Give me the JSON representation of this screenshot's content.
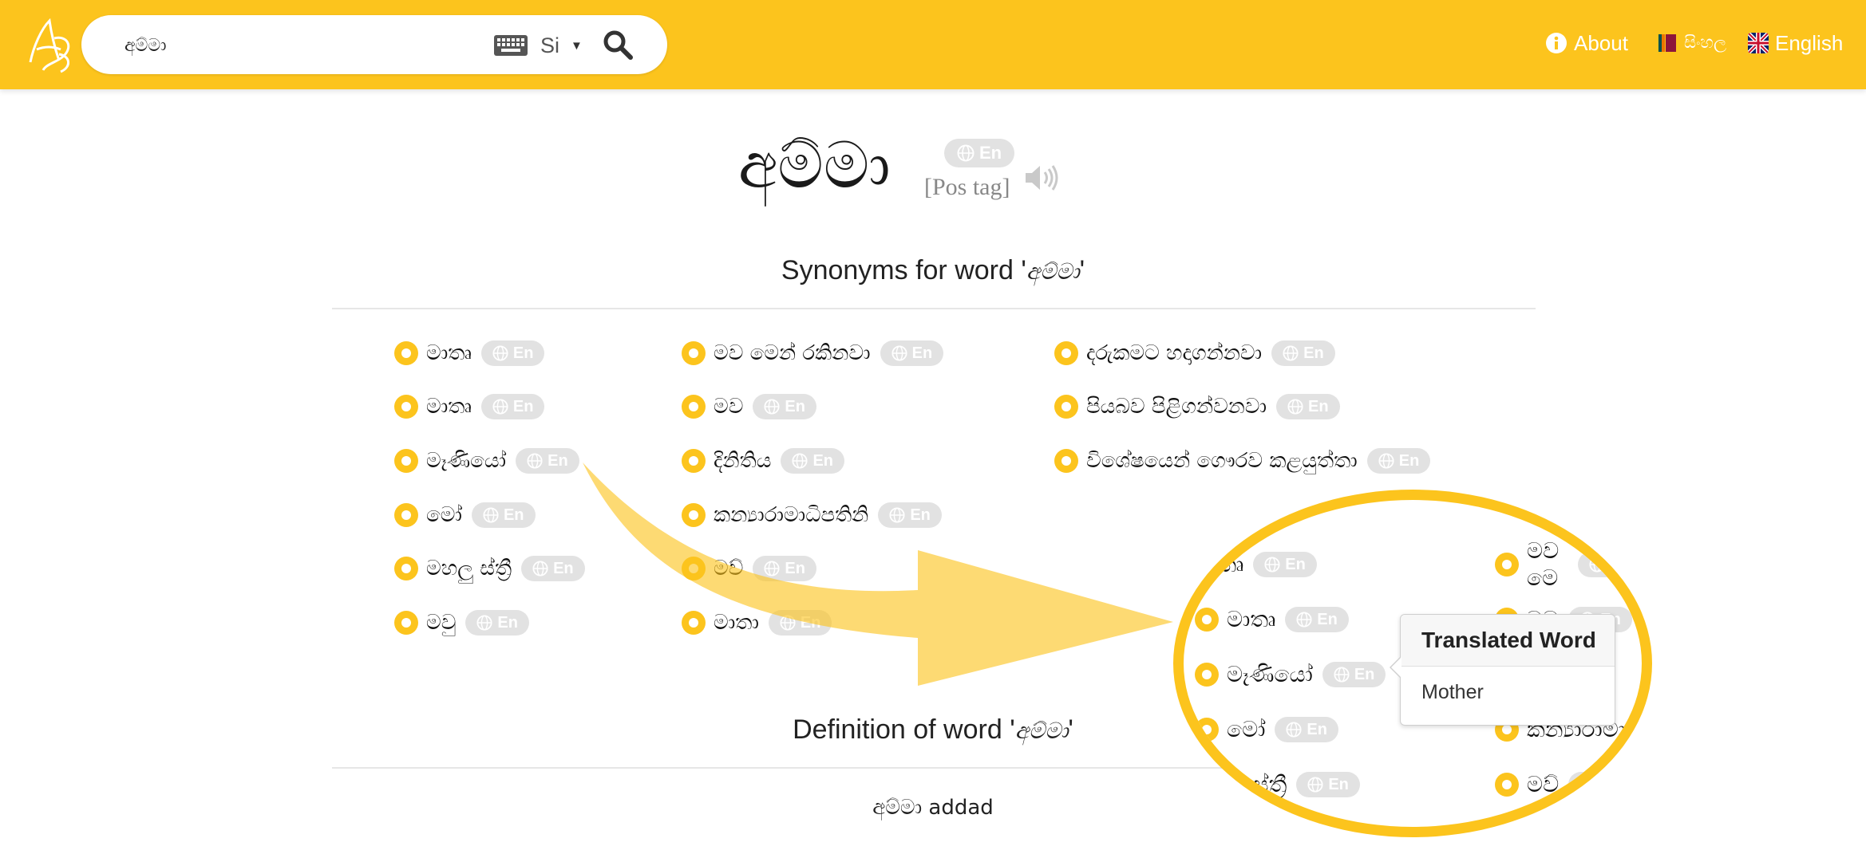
{
  "header": {
    "search_value": "අම්මා",
    "language": "Si",
    "nav": {
      "about": "About",
      "sinhala": "සිංහල",
      "english": "English"
    }
  },
  "word": {
    "text": "අම්මා",
    "badge": "En",
    "pos_tag": "[Pos tag]"
  },
  "synonyms": {
    "title_prefix": "Synonyms for word '",
    "title_word": "අම්මා",
    "title_suffix": "'",
    "badge": "En",
    "col1": [
      "මාතෘ",
      "මාතෘ",
      "මෑණියෝ",
      "මෝ",
      "මහලු ස්ත්‍රී",
      "මවු"
    ],
    "col2": [
      "මව මෙන් රකිනවා",
      "මව",
      "දිනිතිය",
      "කන්‍යාරාමාධිපතිනි",
      "මව්",
      "මාතා"
    ],
    "col3": [
      "දරුකමට හදාගන්නවා",
      "පියබව පිළිගන්වනවා",
      "විශේෂයෙන් ගෞරව කළයුත්තා"
    ]
  },
  "definition": {
    "title_prefix": "Definition of word '",
    "title_word": "අම්මා",
    "title_suffix": "'",
    "text": "අම්මා addad"
  },
  "zoom": {
    "left_items": [
      "මාතෘ",
      "මාතෘ",
      "මෑණියෝ",
      "මෝ",
      "මහලු ස්ත්‍රී"
    ],
    "right_items": [
      "මව මෙ",
      "මව",
      "",
      "කන්‍යාරාමා",
      "මව්"
    ],
    "badge": "En",
    "tooltip_title": "Translated Word",
    "tooltip_body": "Mother"
  },
  "colors": {
    "accent": "#fcc41d",
    "badge_bg": "#e2e2e2"
  }
}
